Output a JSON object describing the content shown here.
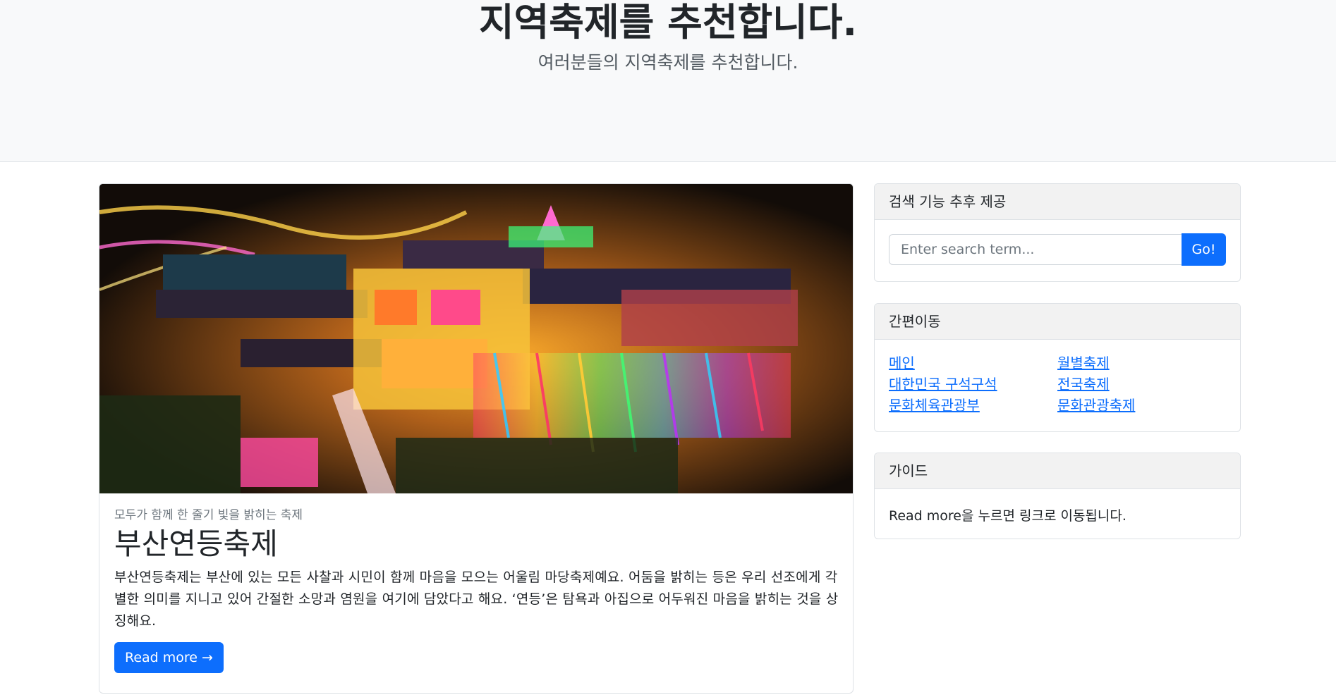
{
  "header": {
    "title": "지역축제를 추천합니다.",
    "subtitle": "여러분들의 지역축제를 추천합니다."
  },
  "featured_post": {
    "image_description_icon": "festival-night-photo",
    "date": "모두가 함께 한 줄기 빛을 밝히는 축제",
    "title": "부산연등축제",
    "text": "부산연등축제는 부산에 있는 모든 사찰과 시민이 함께 마음을 모으는 어울림 마당축제예요. 어둠을 밝히는 등은 우리 선조에게 각별한 의미를 지니고 있어 간절한 소망과 염원을 여기에 담았다고 해요. ‘연등’은 탐욕과 아집으로 어두워진 마음을 밝히는 것을 상징해요.",
    "button_label": "Read more →"
  },
  "search_widget": {
    "header": "검색 기능 추후 제공",
    "placeholder": "Enter search term...",
    "button_label": "Go!"
  },
  "categories_widget": {
    "header": "간편이동",
    "left_links": [
      "메인",
      "대한민국 구석구석",
      "문화체육관광부"
    ],
    "right_links": [
      "월별축제",
      "전국축제",
      "문화관광축제"
    ]
  },
  "guide_widget": {
    "header": "가이드",
    "text": "Read more을 누르면 링크로 이동됩니다."
  },
  "colors": {
    "primary": "#0d6efd",
    "hero_bg": "#f8f9fa"
  }
}
